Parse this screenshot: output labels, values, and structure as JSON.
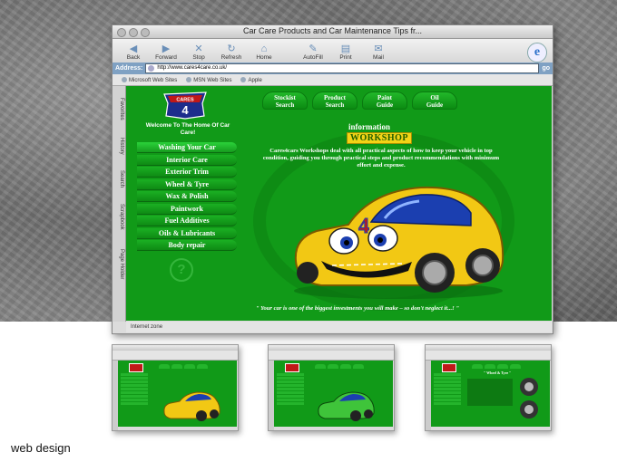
{
  "browser": {
    "title": "Car Care Products and Car Maintenance Tips fr...",
    "toolbar": [
      {
        "icon": "back-arrow-icon",
        "label": "Back",
        "glyph": "◀"
      },
      {
        "icon": "forward-arrow-icon",
        "label": "Forward",
        "glyph": "▶"
      },
      {
        "icon": "stop-icon",
        "label": "Stop",
        "glyph": "✕"
      },
      {
        "icon": "refresh-icon",
        "label": "Refresh",
        "glyph": "↻"
      },
      {
        "icon": "home-icon",
        "label": "Home",
        "glyph": "⌂"
      },
      {
        "icon": "autofill-icon",
        "label": "AutoFill",
        "glyph": "✎"
      },
      {
        "icon": "print-icon",
        "label": "Print",
        "glyph": "▤"
      },
      {
        "icon": "mail-icon",
        "label": "Mail",
        "glyph": "✉"
      }
    ],
    "address_label": "Address:",
    "address_value": "http://www.cares4care.co.uk/",
    "go_label": "go",
    "favorites": [
      "Microsoft Web Sites",
      "MSN Web Sites",
      "Apple"
    ],
    "side_tabs": [
      "Favorites",
      "History",
      "Search",
      "Scrapbook",
      "Page Holder"
    ],
    "status": "Internet zone"
  },
  "site": {
    "logo_text": "CARES 4 CARE",
    "welcome": "Welcome To The Home Of Car Care!",
    "menu": [
      "Washing Your Car",
      "Interior Care",
      "Exterior Trim",
      "Wheel & Tyre",
      "Wax & Polish",
      "Paintwork",
      "Fuel Additives",
      "Oils & Lubricants",
      "Body repair"
    ],
    "nav_tabs": [
      {
        "line1": "Stockist",
        "line2": "Search"
      },
      {
        "line1": "Product",
        "line2": "Search"
      },
      {
        "line1": "Paint",
        "line2": "Guide"
      },
      {
        "line1": "Oil",
        "line2": "Guide"
      }
    ],
    "info_title": "information",
    "workshop_title": "WORKSHOP",
    "blurb": "Cares4cars Workshops deal with all practical aspects of how to keep your vehicle in top condition, guiding you through practical steps and product recommendations with minimum effort and expense.",
    "car_number": "4",
    "tagline": "\" Your car is one of the biggest investments you will make – so don't neglect it...! \"",
    "help_glyph": "?"
  },
  "thumbnails": [
    {
      "variant": "yellow-car",
      "car_color": "#f2c814"
    },
    {
      "variant": "green-car",
      "car_color": "#3fc43a"
    },
    {
      "variant": "wheel-tyre",
      "heading": "\" Wheel & Tyre \""
    }
  ],
  "caption": "web design",
  "colors": {
    "site_green": "#119a18",
    "workshop_yellow": "#f3d316",
    "car_yellow": "#f2c814",
    "logo_red": "#c01818"
  }
}
